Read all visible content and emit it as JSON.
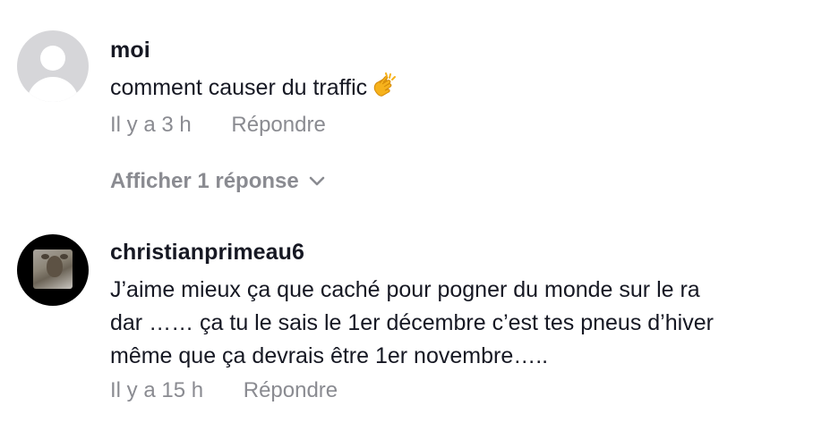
{
  "comments": [
    {
      "username": "moi",
      "text": "comment causer du traffic",
      "emoji": "clapping-hands-emoji",
      "time": "Il y a 3 h",
      "reply_label": "Répondre",
      "avatar": "default-avatar"
    },
    {
      "username": "christianprimeau6",
      "lines": [
        "J’aime mieux ça que caché pour pogner du monde sur le ra",
        "dar …… ça tu le sais le 1er décembre c’est tes pneus d’hiver",
        "même que ça devrais être 1er novembre….."
      ],
      "time": "Il y a 15 h",
      "reply_label": "Répondre",
      "avatar": "deer-photo-avatar"
    }
  ],
  "show_replies": {
    "label": "Afficher 1 réponse",
    "icon": "chevron-down-icon"
  },
  "colors": {
    "text": "#161823",
    "muted": "#8a8b91",
    "default_avatar_bg": "#d6d6d9"
  }
}
